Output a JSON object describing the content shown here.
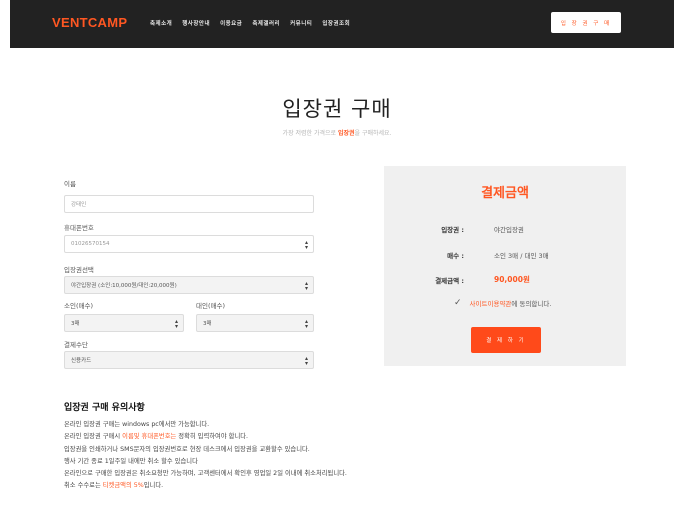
{
  "header": {
    "logo": "VENTCAMP",
    "nav": [
      "축제소개",
      "행사장안내",
      "이용요금",
      "축제갤러리",
      "커뮤니티",
      "입장권조회"
    ],
    "buy_button": "입 장 권 구 매"
  },
  "page": {
    "title": "입장권 구매",
    "subtitle_pre": "가장 저렴한 가격으로 ",
    "subtitle_hl": "입장권",
    "subtitle_post": "을 구매하세요."
  },
  "form": {
    "name_label": "이름",
    "name_value": "강태인",
    "phone_label": "휴대폰번호",
    "phone_value": "01026570154",
    "ticket_label": "입장권선택",
    "ticket_value": "야간입장권 (소인:10,000원/대인:20,000원)",
    "child_label": "소인(매수)",
    "child_value": "3매",
    "adult_label": "대인(매수)",
    "adult_value": "3매",
    "payment_label": "결제수단",
    "payment_value": "신용카드"
  },
  "summary": {
    "title": "결제금액",
    "ticket_key": "입장권 :",
    "ticket_val": "야간입장권",
    "count_key": "매수 :",
    "count_val": "소인 3매 / 대인 3매",
    "amount_key": "결제금액 :",
    "amount_val": "90,000원",
    "agree_link": "사이트이용약관",
    "agree_rest": "에 동의합니다.",
    "pay_button": "결 제 하 기"
  },
  "notices": {
    "title": "입장권 구매 유의사항",
    "line1": "온라인 입장권 구매는 windows pc에서만 가능합니다.",
    "line2_pre": "온라인 입장권 구매시 ",
    "line2_red": "이름및 휴대폰번호는",
    "line2_post": " 정확히 입력하여야 합니다.",
    "line3": "입장권을 인쇄하거나 SMS문자의 입장권번호로 현장 데스크에서 입장권을 교환할수 있습니다.",
    "line4": "행사 기간 종료 1일주일 내에만 취소 할수 있습니다",
    "line5": "온라인으로 구매한 입장권은 취소요청만 가능하며, 고객센터에서 확인후 영업일 2일 이내에 취소처리됩니다.",
    "line6_pre": "취소 수수료는 ",
    "line6_red": "티켓금액의 5%",
    "line6_post": "입니다."
  },
  "colors": {
    "accent": "#ff5722",
    "header_bg": "#222222",
    "summary_bg": "#f0f0f0"
  }
}
